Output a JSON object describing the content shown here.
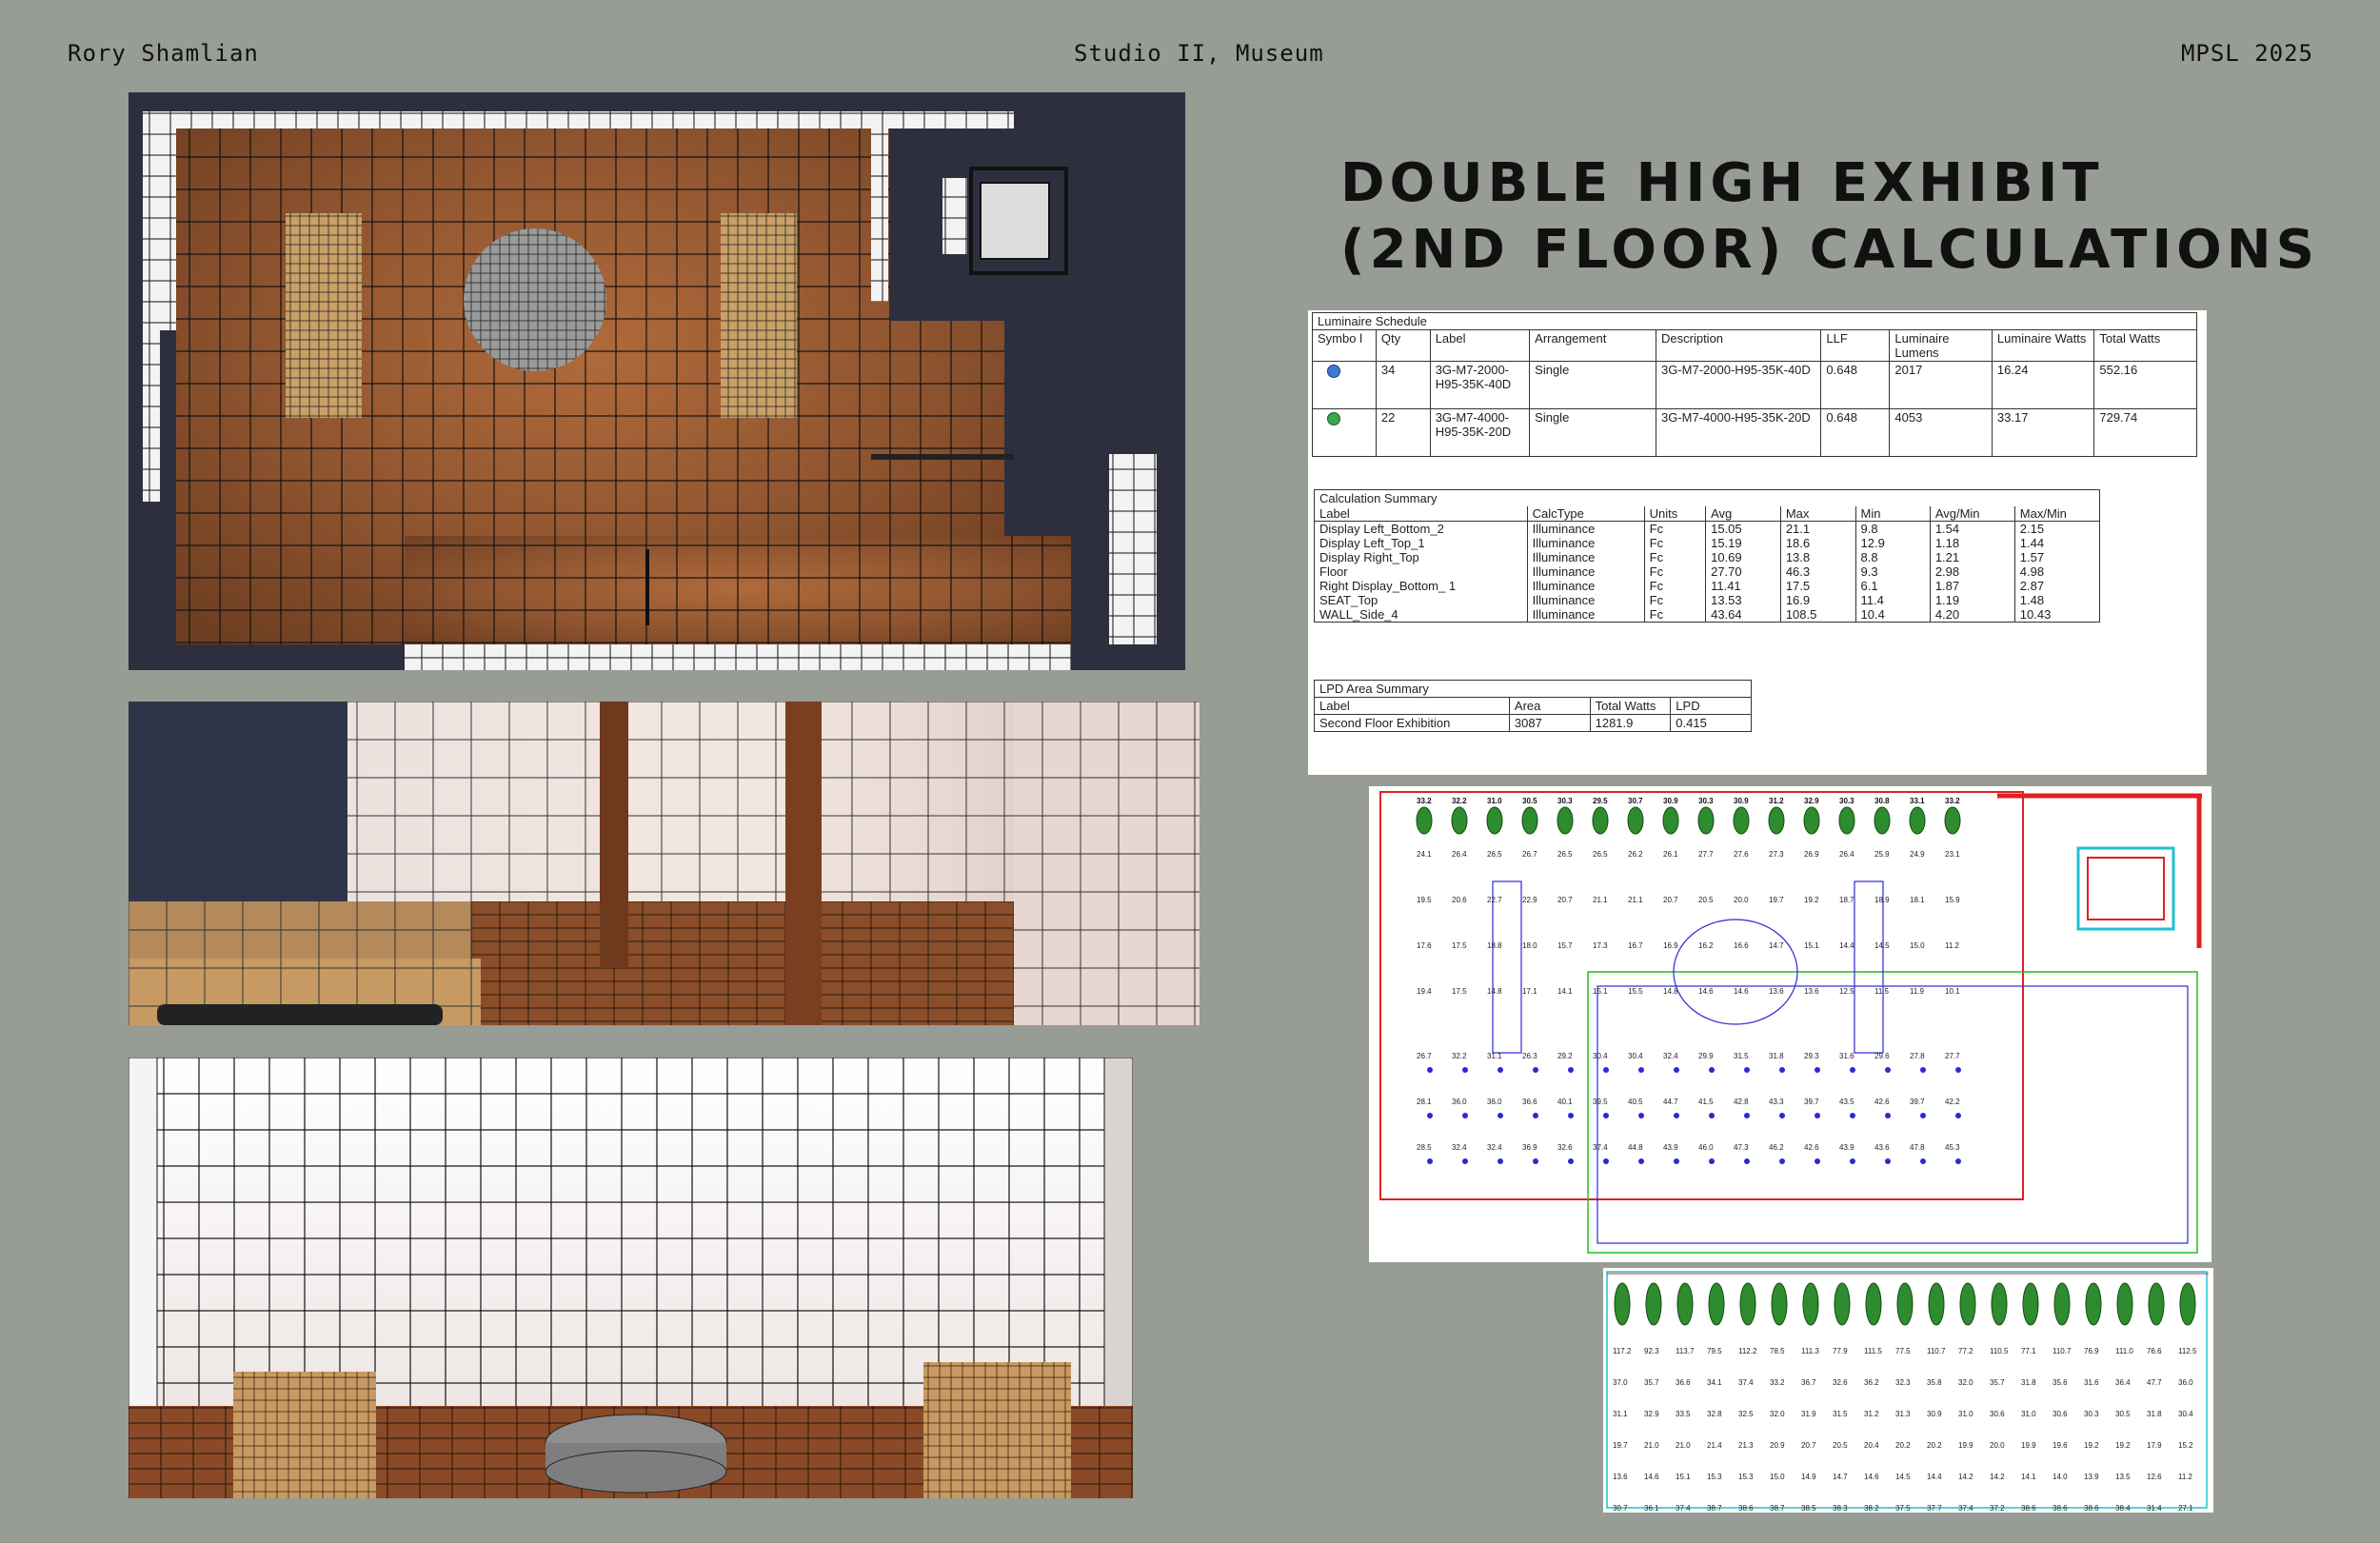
{
  "header": {
    "author": "Rory Shamlian",
    "course": "Studio II, Museum",
    "program": "MPSL 2025"
  },
  "title": {
    "line1": "DOUBLE HIGH EXHIBIT",
    "line2": "(2ND FLOOR) CALCULATIONS"
  },
  "colors": {
    "background": "#979c94",
    "text": "#111111",
    "plan_red": "#e02020",
    "plan_blue": "#2a2ad0",
    "plan_green": "#20c020",
    "plan_cyan": "#20c0d0",
    "luminaire_green": "#2e8b2e"
  },
  "luminaire_schedule": {
    "caption": "Luminaire Schedule",
    "headers": [
      "Symbo l",
      "Qty",
      "Label",
      "Arrangement",
      "Description",
      "LLF",
      "Luminaire Lumens",
      "Luminaire Watts",
      "Total Watts"
    ],
    "rows": [
      {
        "symbol": "blue-circle-icon",
        "qty": "34",
        "label": "3G-M7-2000-H95-35K-40D",
        "arrangement": "Single",
        "description": "3G-M7-2000-H95-35K-40D",
        "llf": "0.648",
        "lumens": "2017",
        "watts": "16.24",
        "total_watts": "552.16"
      },
      {
        "symbol": "green-circle-icon",
        "qty": "22",
        "label": "3G-M7-4000-H95-35K-20D",
        "arrangement": "Single",
        "description": "3G-M7-4000-H95-35K-20D",
        "llf": "0.648",
        "lumens": "4053",
        "watts": "33.17",
        "total_watts": "729.74"
      }
    ]
  },
  "calculation_summary": {
    "caption": "Calculation Summary",
    "headers": [
      "Label",
      "CalcType",
      "Units",
      "Avg",
      "Max",
      "Min",
      "Avg/Min",
      "Max/Min"
    ],
    "rows": [
      [
        "Display Left_Bottom_2",
        "Illuminance",
        "Fc",
        "15.05",
        "21.1",
        "9.8",
        "1.54",
        "2.15"
      ],
      [
        "Display Left_Top_1",
        "Illuminance",
        "Fc",
        "15.19",
        "18.6",
        "12.9",
        "1.18",
        "1.44"
      ],
      [
        "Display Right_Top",
        "Illuminance",
        "Fc",
        "10.69",
        "13.8",
        "8.8",
        "1.21",
        "1.57"
      ],
      [
        "Floor",
        "Illuminance",
        "Fc",
        "27.70",
        "46.3",
        "9.3",
        "2.98",
        "4.98"
      ],
      [
        "Right Display_Bottom_ 1",
        "Illuminance",
        "Fc",
        "11.41",
        "17.5",
        "6.1",
        "1.87",
        "2.87"
      ],
      [
        "SEAT_Top",
        "Illuminance",
        "Fc",
        "13.53",
        "16.9",
        "11.4",
        "1.19",
        "1.48"
      ],
      [
        "WALL_Side_4",
        "Illuminance",
        "Fc",
        "43.64",
        "108.5",
        "10.4",
        "4.20",
        "10.43"
      ]
    ]
  },
  "lpd_summary": {
    "caption": "LPD Area Summary",
    "headers": [
      "Label",
      "Area",
      "Total Watts",
      "LPD"
    ],
    "rows": [
      [
        "Second Floor Exhibition",
        "3087",
        "1281.9",
        "0.415"
      ]
    ]
  },
  "floor_plan": {
    "top_row": [
      "33.2",
      "32.2",
      "31.0",
      "30.5",
      "30.3",
      "29.5",
      "30.7",
      "30.9",
      "30.3",
      "30.9",
      "31.2",
      "32.9",
      "30.3",
      "30.8",
      "33.1",
      "33.2"
    ],
    "rows": [
      [
        "24.1",
        "26.4",
        "26.5",
        "26.7",
        "26.5",
        "26.5",
        "26.2",
        "26.1",
        "27.7",
        "27.6",
        "27.3",
        "26.9",
        "26.4",
        "25.9",
        "24.9",
        "23.1"
      ],
      [
        "19.5",
        "20.6",
        "22.7",
        "22.9",
        "20.7",
        "21.1",
        "21.1",
        "20.7",
        "20.5",
        "20.0",
        "19.7",
        "19.2",
        "18.7",
        "18.9",
        "18.1",
        "15.9"
      ],
      [
        "17.6",
        "17.5",
        "18.8",
        "18.0",
        "15.7",
        "17.3",
        "16.7",
        "16.9",
        "16.2",
        "16.6",
        "14.7",
        "15.1",
        "14.4",
        "14.5",
        "15.0",
        "11.2"
      ],
      [
        "19.4",
        "17.5",
        "14.8",
        "17.1",
        "14.1",
        "15.1",
        "15.5",
        "14.8",
        "14.6",
        "14.6",
        "13.6",
        "13.6",
        "12.5",
        "11.5",
        "11.9",
        "10.1"
      ],
      [
        "26.7",
        "32.2",
        "31.1",
        "26.3",
        "29.2",
        "30.4",
        "30.4",
        "32.4",
        "29.9",
        "31.5",
        "31.8",
        "29.3",
        "31.6",
        "29.6",
        "27.8",
        "27.7"
      ],
      [
        "28.1",
        "36.0",
        "36.0",
        "36.6",
        "40.1",
        "39.5",
        "40.5",
        "44.7",
        "41.5",
        "42.8",
        "43.3",
        "39.7",
        "43.5",
        "42.6",
        "39.7",
        "42.2"
      ],
      [
        "28.5",
        "32.4",
        "32.4",
        "36.9",
        "32.6",
        "37.4",
        "44.8",
        "43.9",
        "46.0",
        "47.3",
        "46.2",
        "42.6",
        "43.9",
        "43.6",
        "47.8",
        "45.3"
      ]
    ],
    "lower_rows": [
      [
        "117.2",
        "92.3",
        "113.7",
        "79.5",
        "112.2",
        "78.5",
        "111.3",
        "77.9",
        "111.5",
        "77.5",
        "110.7",
        "77.2",
        "110.5",
        "77.1",
        "110.7",
        "76.9",
        "111.0",
        "76.6",
        "112.5"
      ],
      [
        "37.0",
        "35.7",
        "36.6",
        "34.1",
        "37.4",
        "33.2",
        "36.7",
        "32.6",
        "36.2",
        "32.3",
        "35.8",
        "32.0",
        "35.7",
        "31.8",
        "35.6",
        "31.6",
        "36.4",
        "47.7",
        "36.0"
      ],
      [
        "31.1",
        "32.9",
        "33.5",
        "32.8",
        "32.5",
        "32.0",
        "31.9",
        "31.5",
        "31.2",
        "31.3",
        "30.9",
        "31.0",
        "30.6",
        "31.0",
        "30.6",
        "30.3",
        "30.5",
        "31.8",
        "30.4"
      ],
      [
        "19.7",
        "21.0",
        "21.0",
        "21.4",
        "21.3",
        "20.9",
        "20.7",
        "20.5",
        "20.4",
        "20.2",
        "20.2",
        "19.9",
        "20.0",
        "19.9",
        "19.6",
        "19.2",
        "19.2",
        "17.9",
        "15.2"
      ],
      [
        "13.6",
        "14.6",
        "15.1",
        "15.3",
        "15.3",
        "15.0",
        "14.9",
        "14.7",
        "14.6",
        "14.5",
        "14.4",
        "14.2",
        "14.2",
        "14.1",
        "14.0",
        "13.9",
        "13.5",
        "12.6",
        "11.2"
      ],
      [
        "30.7",
        "36.1",
        "37.4",
        "38.7",
        "38.6",
        "38.7",
        "38.5",
        "38.3",
        "38.2",
        "37.5",
        "37.7",
        "37.4",
        "37.2",
        "38.6",
        "38.6",
        "38.6",
        "38.4",
        "31.4",
        "27.1"
      ]
    ]
  }
}
